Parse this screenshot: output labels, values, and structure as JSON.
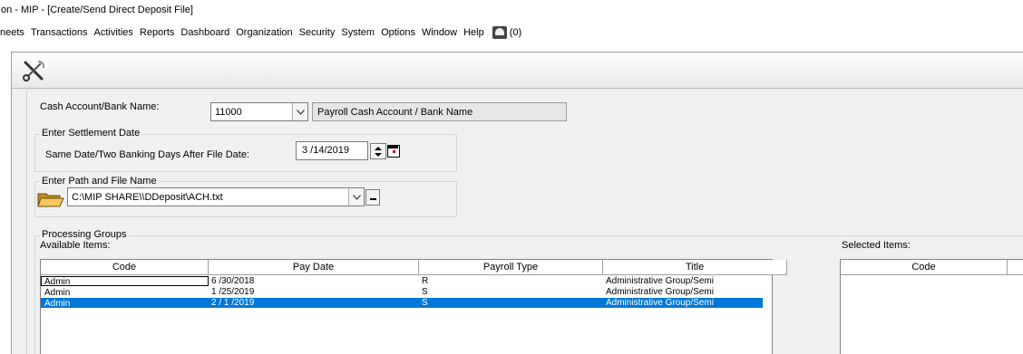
{
  "window": {
    "title": "on - MIP - [Create/Send Direct Deposit File]"
  },
  "menu": {
    "items": [
      "neets",
      "Transactions",
      "Activities",
      "Reports",
      "Dashboard",
      "Organization",
      "Security",
      "System",
      "Options",
      "Window",
      "Help"
    ],
    "notification_count": "(0)"
  },
  "toolbar": {
    "icon": "tools-icon"
  },
  "cash_account": {
    "label": "Cash Account/Bank Name:",
    "value": "11000",
    "name": "Payroll Cash Account / Bank Name"
  },
  "settlement": {
    "group_label": "Enter Settlement Date",
    "label": "Same Date/Two Banking Days After File Date:",
    "date": "3 /14/2019"
  },
  "file_path": {
    "group_label": "Enter Path and File Name",
    "value": "C:\\MIP SHARE\\\\DDeposit\\ACH.txt"
  },
  "processing": {
    "group_label": "Processing Groups",
    "available_label": "Available Items:",
    "selected_label": "Selected Items:",
    "available_columns": [
      "Code",
      "Pay Date",
      "Payroll Type",
      "Title"
    ],
    "selected_columns": [
      "Code",
      ""
    ],
    "rows": [
      {
        "code": "Admin",
        "pay_date": "6 /30/2018",
        "payroll_type": "R",
        "title": "Administrative Group/Semi"
      },
      {
        "code": "Admin",
        "pay_date": "1 /25/2019",
        "payroll_type": "S",
        "title": "Administrative Group/Semi"
      },
      {
        "code": "Admin",
        "pay_date": "2 / 1 /2019",
        "payroll_type": "S",
        "title": "Administrative Group/Semi"
      }
    ],
    "selected_row_index": 2
  },
  "colors": {
    "selection": "#0078d7",
    "panel_bg": "#f0f0f0"
  }
}
